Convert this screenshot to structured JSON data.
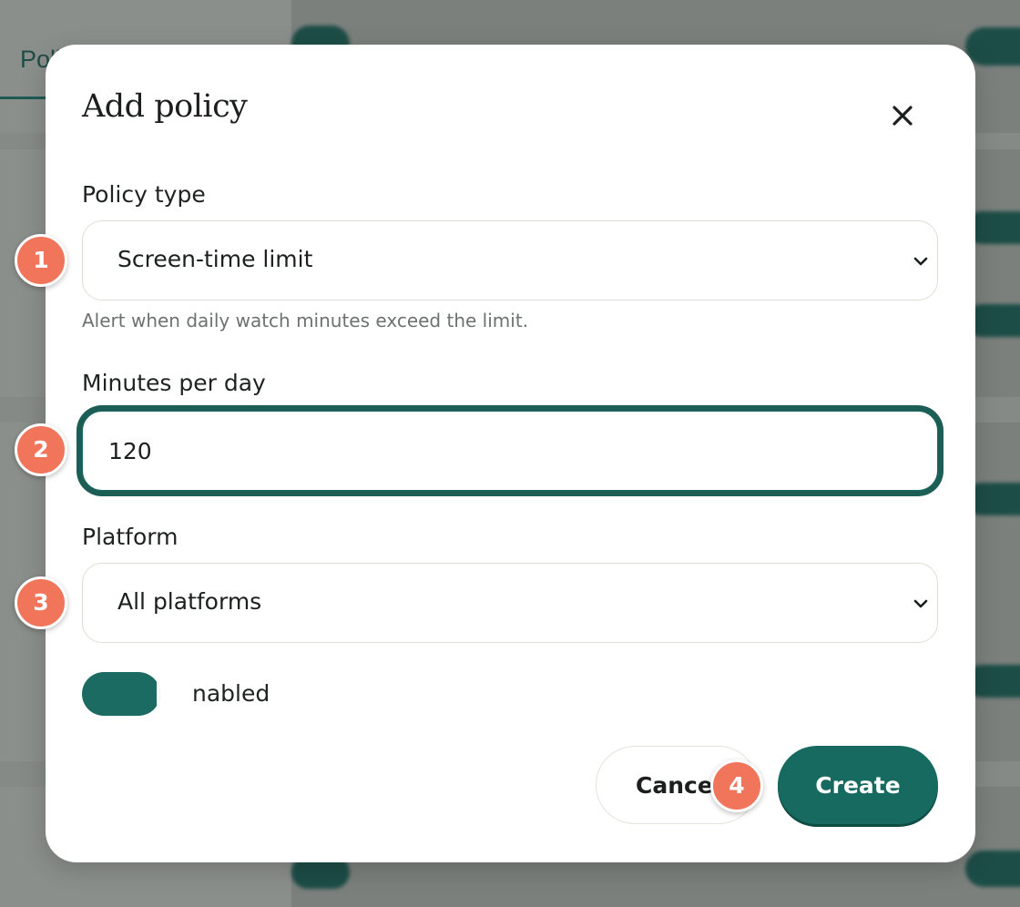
{
  "background": {
    "tab_label": "Poli"
  },
  "dialog": {
    "title": "Add policy",
    "close_icon": "close-icon",
    "policy_type": {
      "label": "Policy type",
      "selected": "Screen-time limit",
      "helper": "Alert when daily watch minutes exceed the limit."
    },
    "minutes": {
      "label": "Minutes per day",
      "value": "120"
    },
    "platform": {
      "label": "Platform",
      "selected": "All platforms"
    },
    "enabled_toggle": {
      "label": "nabled",
      "on": true
    },
    "buttons": {
      "cancel": "Cance",
      "create": "Create"
    }
  },
  "markers": [
    "1",
    "2",
    "3",
    "4"
  ],
  "colors": {
    "accent": "#176a5f",
    "marker": "#f0755b"
  }
}
